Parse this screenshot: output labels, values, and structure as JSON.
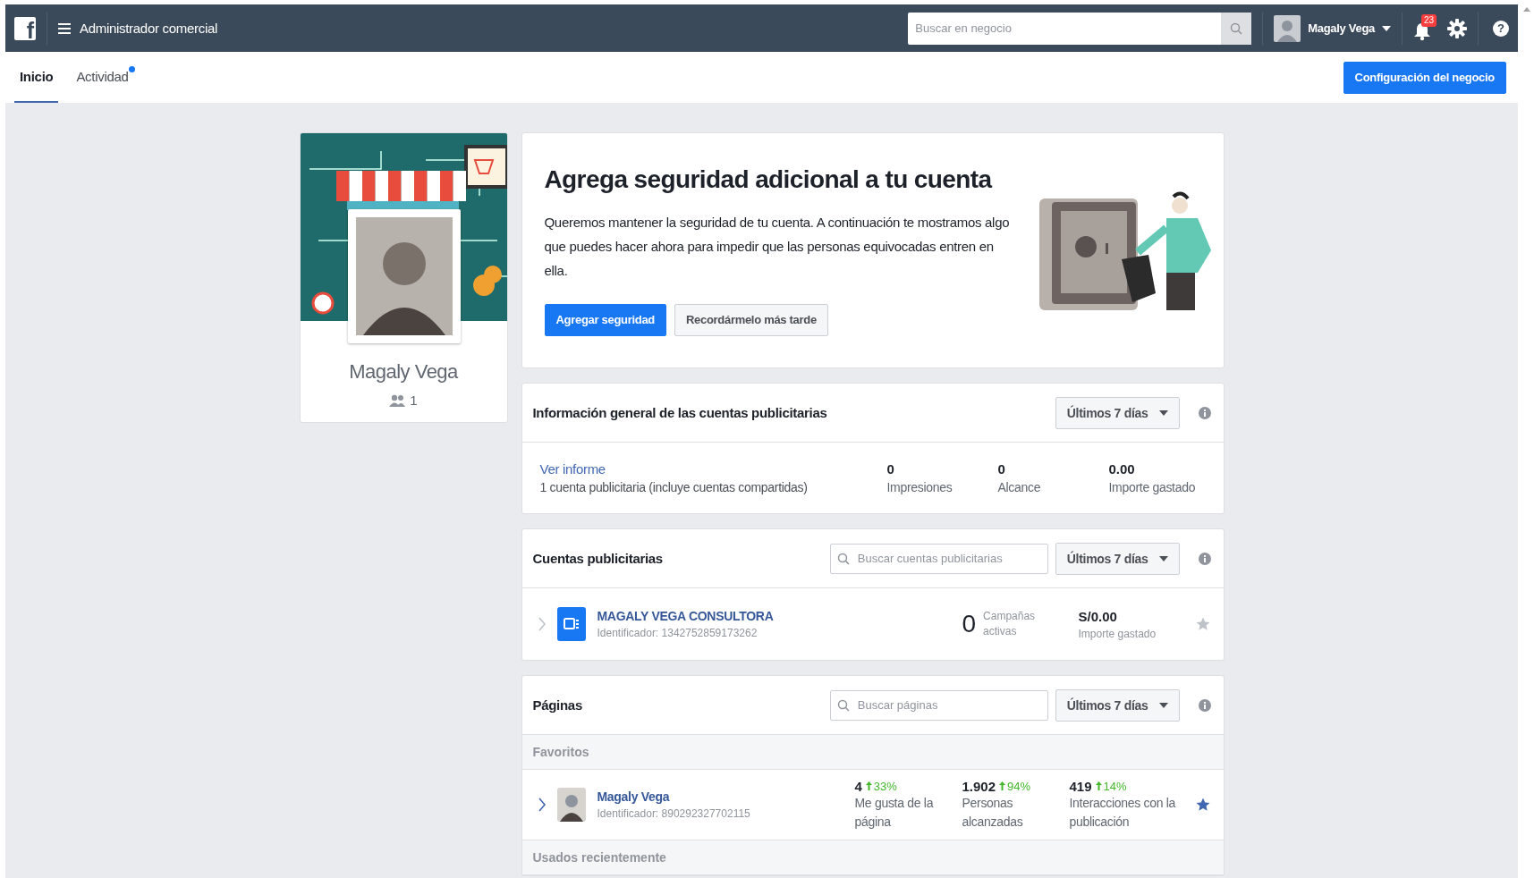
{
  "top_bar": {
    "logo": "f",
    "title": "Administrador comercial",
    "search": {
      "placeholder": "Buscar en negocio"
    },
    "user": {
      "name": "Magaly Vega"
    },
    "notifications": {
      "count": "23"
    },
    "help": "?"
  },
  "tabs": [
    {
      "label": "Inicio",
      "selected": true,
      "unread": false
    },
    {
      "label": "Actividad",
      "selected": false,
      "unread": true
    }
  ],
  "settings_button": "Configuración del negocio",
  "profile": {
    "name": "Magaly Vega",
    "people_count": "1"
  },
  "security_banner": {
    "title": "Agrega seguridad adicional a tu cuenta",
    "text": "Queremos mantener la seguridad de tu cuenta. A continuación te mostramos algo que puedes hacer ahora para impedir que las personas equivocadas entren en ella.",
    "buttons": [
      {
        "label": "Agregar seguridad",
        "kind": "primary"
      },
      {
        "label": "Recordármelo más tarde",
        "kind": "secondary"
      }
    ]
  },
  "ad_overview": {
    "title": "Información general de las cuentas publicitarias",
    "range": "Últimos 7 días",
    "link": "Ver informe",
    "subtitle": "1 cuenta publicitaria (incluye cuentas compartidas)",
    "stats": [
      {
        "value": "0",
        "label": "Impresiones"
      },
      {
        "value": "0",
        "label": "Alcance"
      },
      {
        "value": "0.00",
        "label": "Importe gastado"
      }
    ]
  },
  "ad_accounts": {
    "title": "Cuentas publicitarias",
    "search": {
      "placeholder": "Buscar cuentas publicitarias"
    },
    "range": "Últimos 7 días",
    "rows": [
      {
        "name": "MAGALY VEGA CONSULTORA",
        "id": "Identificador: 1342752859173262",
        "count": "0",
        "count_label": "Campañas activas",
        "spent": "S/0.00",
        "spent_label": "Importe gastado",
        "favorite": false
      }
    ]
  },
  "pages": {
    "title": "Páginas",
    "search": {
      "placeholder": "Buscar páginas"
    },
    "range": "Últimos 7 días",
    "groups": [
      {
        "label": "Favoritos",
        "rows": [
          {
            "name": "Magaly Vega",
            "id": "Identificador: 890292327702115",
            "favorite": true,
            "stats": [
              {
                "value": "4",
                "change": "33%",
                "label": "Me gusta de la página"
              },
              {
                "value": "1.902",
                "change": "94%",
                "label": "Personas alcanzadas"
              },
              {
                "value": "419",
                "change": "14%",
                "label": "Interacciones con la publicación"
              }
            ]
          }
        ]
      },
      {
        "label": "Usados recientemente"
      }
    ]
  }
}
